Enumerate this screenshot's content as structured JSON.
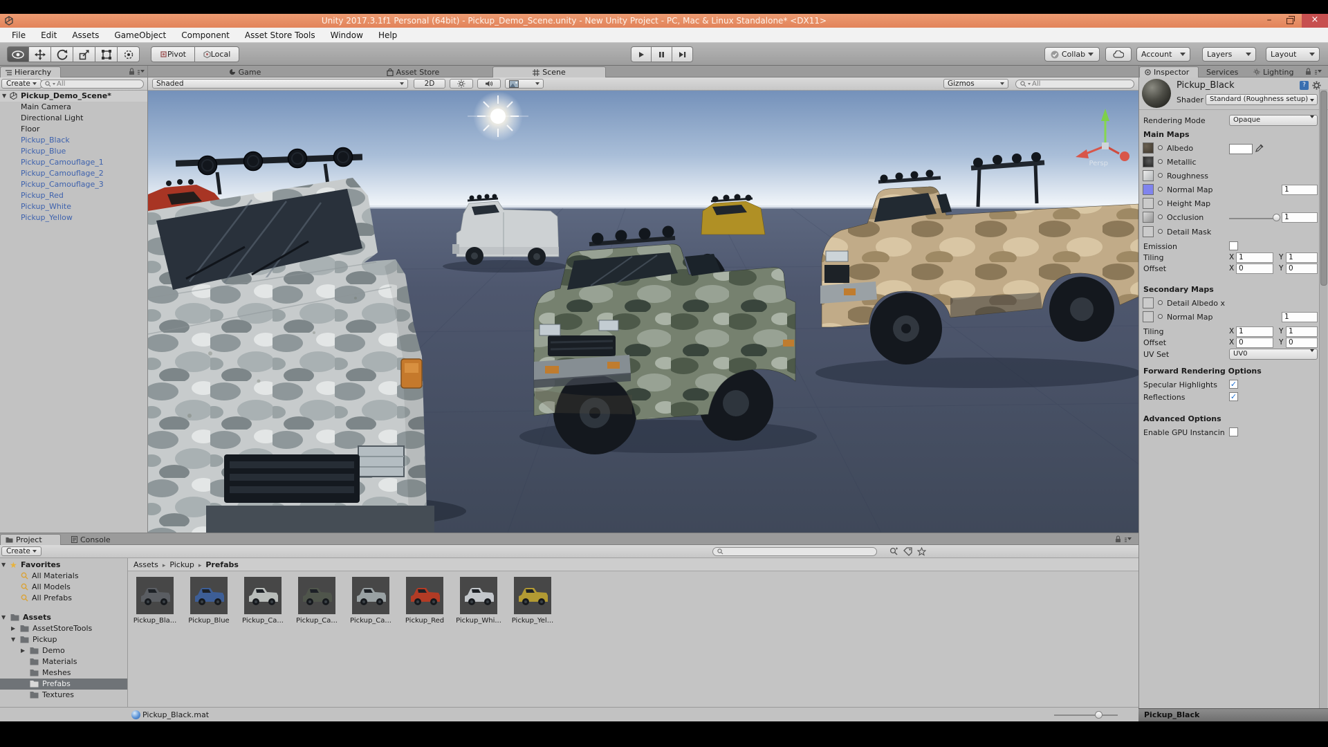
{
  "window": {
    "title": "Unity 2017.3.1f1 Personal (64bit) - Pickup_Demo_Scene.unity - New Unity Project - PC, Mac & Linux Standalone* <DX11>",
    "minimize": "–",
    "close": "×"
  },
  "colors": {
    "titlebar": "#e78a5e",
    "close_button": "#c75050",
    "prefab_text": "#3e62ad",
    "selection_gray": "#6f7377",
    "check_accent": "#1f6fd0"
  },
  "menu": {
    "items": [
      "File",
      "Edit",
      "Assets",
      "GameObject",
      "Component",
      "Asset Store Tools",
      "Window",
      "Help"
    ]
  },
  "toolbar": {
    "tools": [
      "hand",
      "move",
      "rotate",
      "scale",
      "rect",
      "transform"
    ],
    "pivot": "Pivot",
    "local": "Local",
    "collab": "Collab",
    "account": "Account",
    "layers": "Layers",
    "layout": "Layout"
  },
  "hierarchy": {
    "tab": "Hierarchy",
    "create": "Create",
    "search": "All",
    "root": "Pickup_Demo_Scene*",
    "items": [
      "Main Camera",
      "Directional Light",
      "Floor",
      "Pickup_Black",
      "Pickup_Blue",
      "Pickup_Camouflage_1",
      "Pickup_Camouflage_2",
      "Pickup_Camouflage_3",
      "Pickup_Red",
      "Pickup_White",
      "Pickup_Yellow"
    ]
  },
  "scene": {
    "tab_game": "Game",
    "tab_asset_store": "Asset Store",
    "tab_scene": "Scene",
    "toolbar": {
      "shaded": "Shaded",
      "two_d": "2D",
      "gizmos": "Gizmos",
      "search": "All"
    },
    "persp": "Persp"
  },
  "inspector": {
    "tab_inspector": "Inspector",
    "tab_services": "Services",
    "tab_lighting": "Lighting",
    "material_name": "Pickup_Black",
    "help_glyph": "?",
    "shader_label": "Shader",
    "shader_value": "Standard (Roughness setup)",
    "rendering_mode_label": "Rendering Mode",
    "rendering_mode_value": "Opaque",
    "main_maps_title": "Main Maps",
    "albedo_label": "Albedo",
    "metallic_label": "Metallic",
    "roughness_label": "Roughness",
    "normal_map_label": "Normal Map",
    "normal_map_value": "1",
    "height_map_label": "Height Map",
    "occlusion_label": "Occlusion",
    "occlusion_value": "1",
    "detail_mask_label": "Detail Mask",
    "emission_label": "Emission",
    "tiling_label": "Tiling",
    "offset_label": "Offset",
    "x_label": "X",
    "y_label": "Y",
    "tiling_x": "1",
    "tiling_y": "1",
    "offset_x": "0",
    "offset_y": "0",
    "secondary_maps_title": "Secondary Maps",
    "detail_albedo_label": "Detail Albedo x",
    "sec_normal_label": "Normal Map",
    "sec_normal_value": "1",
    "sec_tiling_x": "1",
    "sec_tiling_y": "1",
    "sec_offset_x": "0",
    "sec_offset_y": "0",
    "uv_set_label": "UV Set",
    "uv_set_value": "UV0",
    "forward_title": "Forward Rendering Options",
    "specular_label": "Specular Highlights",
    "reflections_label": "Reflections",
    "advanced_title": "Advanced Options",
    "gpu_label": "Enable GPU Instancin",
    "check_glyph": "✓",
    "preview_title": "Pickup_Black"
  },
  "project": {
    "tab_project": "Project",
    "tab_console": "Console",
    "create": "Create",
    "favorites_label": "Favorites",
    "favorites": [
      "All Materials",
      "All Models",
      "All Prefabs"
    ],
    "assets_label": "Assets",
    "tree": [
      "AssetStoreTools",
      "Pickup",
      "Demo",
      "Materials",
      "Meshes",
      "Prefabs",
      "Textures"
    ],
    "breadcrumb": [
      "Assets",
      "Pickup",
      "Prefabs"
    ],
    "grid": [
      {
        "label": "Pickup_Bla...",
        "color": "#5a5d62"
      },
      {
        "label": "Pickup_Blue",
        "color": "#3d5e96"
      },
      {
        "label": "Pickup_Ca...",
        "color": "#b9bdba"
      },
      {
        "label": "Pickup_Ca...",
        "color": "#4f554b"
      },
      {
        "label": "Pickup_Ca...",
        "color": "#99a1a3"
      },
      {
        "label": "Pickup_Red",
        "color": "#b23b25"
      },
      {
        "label": "Pickup_Whi...",
        "color": "#c3c7cb"
      },
      {
        "label": "Pickup_Yel...",
        "color": "#b29a33"
      }
    ],
    "status_file": "Pickup_Black.mat"
  }
}
